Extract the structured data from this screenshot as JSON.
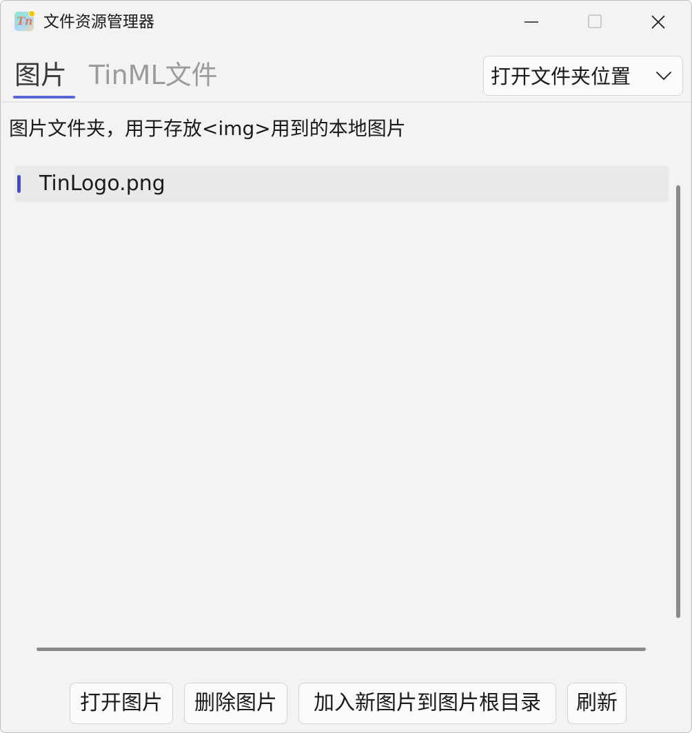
{
  "window": {
    "title": "文件资源管理器",
    "icon": "tin-app-icon"
  },
  "title_controls": [
    "minimize-icon",
    "maximize-icon",
    "close-icon"
  ],
  "tabs": [
    {
      "label": "图片",
      "active": true
    },
    {
      "label": "TinML文件",
      "active": false
    }
  ],
  "open_location": {
    "label": "打开文件夹位置"
  },
  "description": "图片文件夹，用于存放<img>用到的本地图片",
  "files": [
    {
      "name": "TinLogo.png",
      "selected": true
    }
  ],
  "buttons": {
    "open": "打开图片",
    "delete": "删除图片",
    "add": "加入新图片到图片根目录",
    "refresh": "刷新"
  },
  "colors": {
    "accent": "#5b66d6",
    "selection_indicator": "#3d4fd0",
    "background": "#f3f3f3"
  }
}
